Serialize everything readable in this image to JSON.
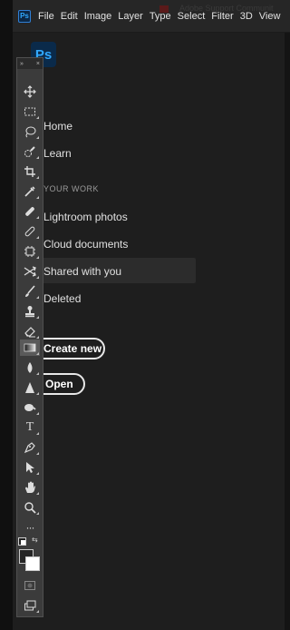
{
  "menubar": {
    "app_badge": "Ps",
    "items": [
      "File",
      "Edit",
      "Image",
      "Layer",
      "Type",
      "Select",
      "Filter",
      "3D",
      "View"
    ],
    "window_title": "Adobe Support Communit"
  },
  "home": {
    "logo": "Ps",
    "nav": {
      "home": "Home",
      "learn": "Learn",
      "section_label": "YOUR WORK",
      "lightroom": "Lightroom photos",
      "cloud": "Cloud documents",
      "shared": "Shared with you",
      "deleted": "Deleted"
    },
    "buttons": {
      "create_new": "Create new",
      "open": "Open"
    }
  },
  "toolbar": {
    "collapse_label": "»",
    "close_label": "×",
    "tools": [
      "move-tool",
      "marquee-tool",
      "lasso-tool",
      "quick-selection-tool",
      "crop-tool",
      "eyedropper-tool",
      "spot-healing-tool",
      "brush-tool",
      "clone-stamp-tool",
      "history-brush-tool",
      "eraser-tool",
      "gradient-tool",
      "blur-tool",
      "dodge-tool",
      "pen-tool",
      "type-tool",
      "path-selection-tool",
      "shape-tool",
      "hand-tool",
      "zoom-tool",
      "more-tools",
      "quick-mask",
      "screen-mode"
    ],
    "type_glyph": "T",
    "more_glyph": "···",
    "foreground_color": "#262626",
    "background_color": "#ffffff"
  },
  "colors": {
    "accent": "#31a8ff",
    "selected_row": "#2c2c2c"
  }
}
